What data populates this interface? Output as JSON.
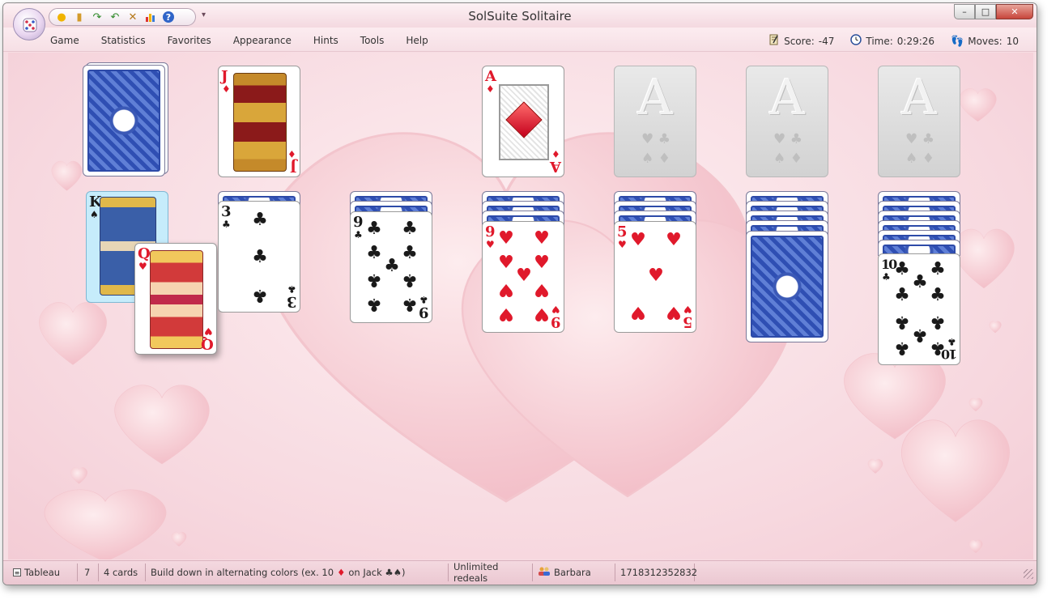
{
  "window": {
    "title": "SolSuite Solitaire",
    "minimize_label": "–",
    "maximize_label": "□",
    "close_label": "✕"
  },
  "quick_toolbar": {
    "icons": [
      "sun-icon",
      "scroll-icon",
      "redo-arrow-icon",
      "undo-arrow-icon",
      "tools-icon",
      "bar-chart-icon",
      "help-icon"
    ],
    "dropdown_label": "▾"
  },
  "menu": [
    "Game",
    "Statistics",
    "Favorites",
    "Appearance",
    "Hints",
    "Tools",
    "Help"
  ],
  "stats": {
    "score_label": "Score:",
    "score_value": "-47",
    "time_label": "Time:",
    "time_value": "0:29:26",
    "moves_label": "Moves:",
    "moves_value": "10"
  },
  "cards": {
    "waste_top": {
      "rank": "J",
      "suit": "♦",
      "color": "#e0192b"
    },
    "foundation_1": {
      "rank": "A",
      "suit": "♦",
      "color": "#e0192b"
    },
    "foundation_placeholder": {
      "rank": "A",
      "suits": "♥ ♣ ♠ ♦"
    },
    "tableau": [
      {
        "face_down": 0,
        "cards": [
          {
            "rank": "K",
            "suit": "♠"
          },
          {
            "rank": "Q",
            "suit": "♥"
          }
        ]
      },
      {
        "face_down": 1,
        "cards": [
          {
            "rank": "3",
            "suit": "♣"
          }
        ]
      },
      {
        "face_down": 2,
        "cards": [
          {
            "rank": "9",
            "suit": "♣"
          }
        ]
      },
      {
        "face_down": 3,
        "cards": [
          {
            "rank": "9",
            "suit": "♥"
          }
        ]
      },
      {
        "face_down": 4,
        "cards": [
          {
            "rank": "5",
            "suit": "♥"
          }
        ]
      },
      {
        "face_down": 5,
        "cards": []
      },
      {
        "face_down": 6,
        "cards": [
          {
            "rank": "10",
            "suit": "♣"
          }
        ]
      }
    ]
  },
  "statusbar": {
    "pile_name": "Tableau",
    "pile_number": "7",
    "pile_count": "4 cards",
    "rule_text_a": "Build down in alternating colors (ex. 10",
    "rule_text_b": "on Jack ♣♠)",
    "rule_diamond": "♦",
    "redeals": "Unlimited redeals",
    "player": "Barbara",
    "game_number": "1718312352832"
  },
  "colors": {
    "red_suit": "#e0192b",
    "card_back": "#2f4fb3",
    "table_background": "#f7d8df"
  }
}
